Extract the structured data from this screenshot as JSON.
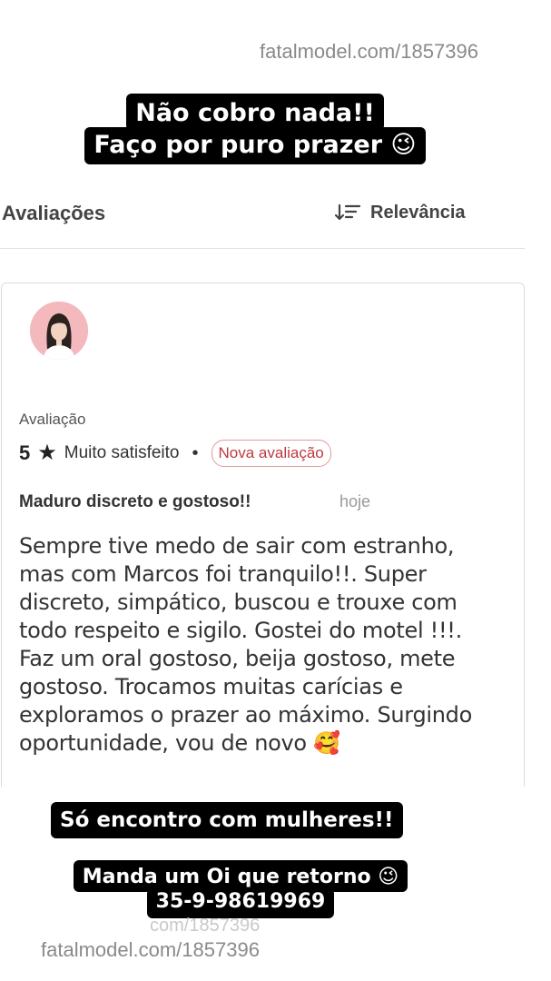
{
  "watermark": {
    "top": "fatalmodel.com/1857396",
    "bottom": "fatalmodel.com/1857396",
    "ghost": "com/1857396"
  },
  "captions": {
    "top_line1": "Não cobro nada!!",
    "top_line2": "Faço por puro prazer 😉",
    "middle": "Só encontro com mulheres!!",
    "bottom_line1": "Manda um Oi que retorno 😉",
    "bottom_line2": "35-9-98619969"
  },
  "reviews": {
    "title": "Avaliações",
    "sort_label": "Relevância",
    "sort_icon": "sort-icon"
  },
  "review": {
    "avatar_icon": "avatar-woman",
    "rating_label": "Avaliação",
    "rating_value": "5",
    "star_icon": "★",
    "rating_text": "Muito satisfeito",
    "separator": "•",
    "badge": "Nova avaliação",
    "headline": "Maduro discreto e gostoso!!",
    "date": "hoje",
    "body": "Sempre tive medo de sair com estranho, mas com Marcos foi tranquilo!!. Super discreto, simpático, buscou e trouxe com todo respeito e sigilo. Gostei do motel !!!. Faz um oral gostoso, beija gostoso, mete gostoso. Trocamos muitas carícias e exploramos o prazer ao máximo. Surgindo oportunidade, vou de novo 🥰"
  },
  "colors": {
    "caption_bg": "#000000",
    "badge_border": "#e39a9e",
    "badge_text": "#c0393f",
    "avatar_bg": "#f3b9bd"
  }
}
